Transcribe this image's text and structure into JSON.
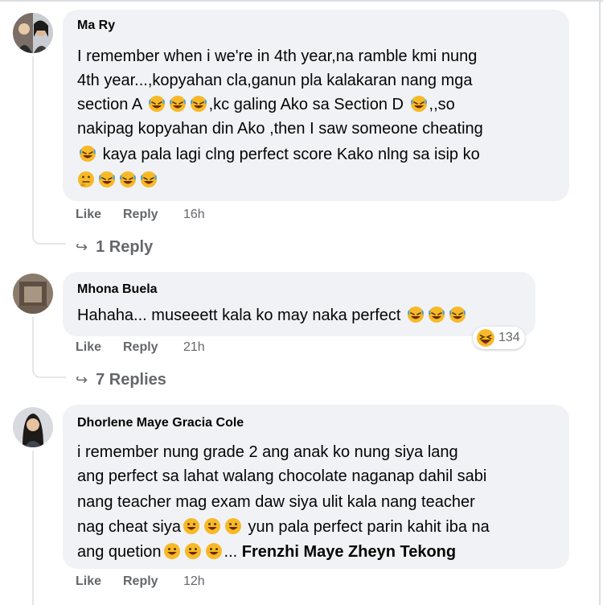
{
  "comments": [
    {
      "author": "Ma Ry",
      "lines": [
        "I remember when i we're in 4th year,na ramble kmi nung",
        "4th year...,kopyahan cla,ganun pla kalakaran nang mga",
        "section A",
        ",kc galing Ako sa Section D",
        ",,so",
        "nakipag kopyahan din Ako ,then I saw someone cheating",
        "kaya pala lagi clng perfect score Kako nlng sa isip ko"
      ],
      "like": "Like",
      "reply": "Reply",
      "time": "16h",
      "replies_label": "1 Reply"
    },
    {
      "author": "Mhona Buela",
      "lines": [
        "Hahaha... museeett kala ko may naka perfect"
      ],
      "like": "Like",
      "reply": "Reply",
      "time": "21h",
      "reaction_count": "134",
      "replies_label": "7 Replies"
    },
    {
      "author": "Dhorlene Maye Gracia Cole",
      "lines": [
        "i remember nung grade 2 ang anak ko nung siya lang",
        "ang perfect sa lahat walang chocolate naganap dahil sabi",
        "nang teacher mag exam daw siya ulit kala nang teacher",
        "nag cheat siya",
        "yun pala perfect parin kahit iba na",
        "ang quetion",
        "Frenzhi Maye Zheyn Tekong"
      ],
      "like": "Like",
      "reply": "Reply",
      "time": "12h"
    }
  ],
  "icons": {
    "laugh": "rofl-emoji",
    "smile": "smiley-emoji",
    "think": "thinking-emoji",
    "reaction": "haha-reaction-icon"
  },
  "colors": {
    "bubble": "#f0f2f5",
    "secondary_text": "#65676b",
    "emoji_yellow": "#f7b928"
  }
}
